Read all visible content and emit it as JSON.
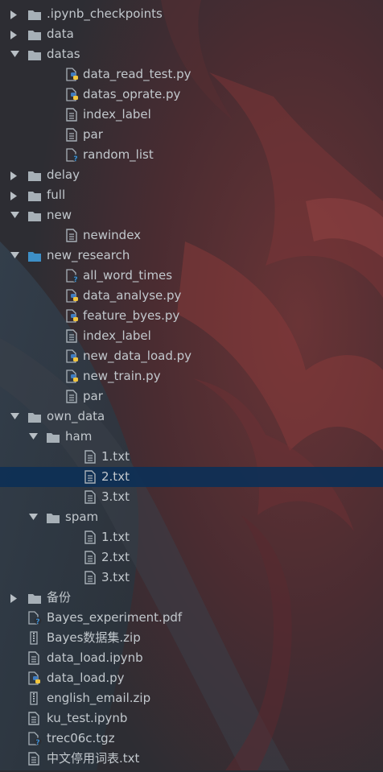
{
  "colors": {
    "selection": "#0d3056",
    "text": "#c2c8cd",
    "folder": "#a7b0b7",
    "folder_selected": "#3d8fc7",
    "python_blue": "#3f7cc0",
    "python_yellow": "#f2c53d",
    "question_badge": "#3a8fd6"
  },
  "tree": [
    {
      "label": ".ipynb_checkpoints",
      "type": "folder",
      "depth": 0,
      "expanded": false
    },
    {
      "label": "data",
      "type": "folder",
      "depth": 0,
      "expanded": false
    },
    {
      "label": "datas",
      "type": "folder",
      "depth": 0,
      "expanded": true
    },
    {
      "label": "data_read_test.py",
      "type": "python",
      "depth": 1
    },
    {
      "label": "datas_oprate.py",
      "type": "python",
      "depth": 1
    },
    {
      "label": "index_label",
      "type": "text",
      "depth": 1
    },
    {
      "label": "par",
      "type": "text",
      "depth": 1
    },
    {
      "label": "random_list",
      "type": "unknown",
      "depth": 1
    },
    {
      "label": "delay",
      "type": "folder",
      "depth": 0,
      "expanded": false
    },
    {
      "label": "full",
      "type": "folder",
      "depth": 0,
      "expanded": false
    },
    {
      "label": "new",
      "type": "folder",
      "depth": 0,
      "expanded": true
    },
    {
      "label": "newindex",
      "type": "text",
      "depth": 1
    },
    {
      "label": "new_research",
      "type": "folder",
      "depth": 0,
      "expanded": true,
      "highlight": true
    },
    {
      "label": "all_word_times",
      "type": "unknown",
      "depth": 1
    },
    {
      "label": "data_analyse.py",
      "type": "python",
      "depth": 1
    },
    {
      "label": "feature_byes.py",
      "type": "python",
      "depth": 1
    },
    {
      "label": "index_label",
      "type": "text",
      "depth": 1
    },
    {
      "label": "new_data_load.py",
      "type": "python",
      "depth": 1
    },
    {
      "label": "new_train.py",
      "type": "python",
      "depth": 1
    },
    {
      "label": "par",
      "type": "text",
      "depth": 1
    },
    {
      "label": "own_data",
      "type": "folder",
      "depth": 0,
      "expanded": true
    },
    {
      "label": "ham",
      "type": "folder",
      "depth": 1,
      "expanded": true
    },
    {
      "label": "1.txt",
      "type": "text",
      "depth": 2
    },
    {
      "label": "2.txt",
      "type": "text",
      "depth": 2,
      "selected": true
    },
    {
      "label": "3.txt",
      "type": "text",
      "depth": 2
    },
    {
      "label": "spam",
      "type": "folder",
      "depth": 1,
      "expanded": true
    },
    {
      "label": "1.txt",
      "type": "text",
      "depth": 2
    },
    {
      "label": "2.txt",
      "type": "text",
      "depth": 2
    },
    {
      "label": "3.txt",
      "type": "text",
      "depth": 2
    },
    {
      "label": "备份",
      "type": "folder",
      "depth": 0,
      "expanded": false
    },
    {
      "label": "Bayes_experiment.pdf",
      "type": "unknown",
      "depth": 0,
      "file_at_root": true
    },
    {
      "label": "Bayes数据集.zip",
      "type": "archive",
      "depth": 0,
      "file_at_root": true
    },
    {
      "label": "data_load.ipynb",
      "type": "text",
      "depth": 0,
      "file_at_root": true
    },
    {
      "label": "data_load.py",
      "type": "python",
      "depth": 0,
      "file_at_root": true
    },
    {
      "label": "english_email.zip",
      "type": "archive",
      "depth": 0,
      "file_at_root": true
    },
    {
      "label": "ku_test.ipynb",
      "type": "text",
      "depth": 0,
      "file_at_root": true
    },
    {
      "label": "trec06c.tgz",
      "type": "unknown",
      "depth": 0,
      "file_at_root": true
    },
    {
      "label": "中文停用词表.txt",
      "type": "text",
      "depth": 0,
      "file_at_root": true
    }
  ]
}
